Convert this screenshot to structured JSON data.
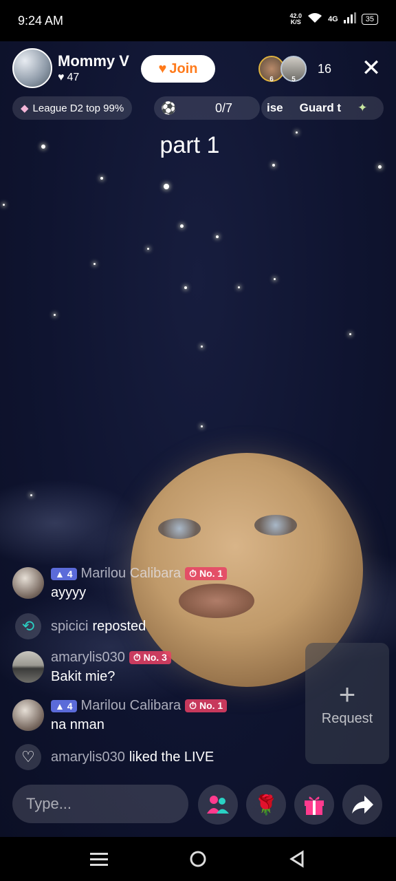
{
  "status": {
    "time": "9:24 AM",
    "net_speed_value": "42.0",
    "net_speed_unit": "K/S",
    "network": "4G",
    "battery": "35"
  },
  "header": {
    "host_name": "Mommy V",
    "host_likes": "47",
    "join_label": "Join",
    "viewer_badges": [
      "6",
      "5"
    ],
    "viewer_count": "16",
    "close_icon": "close-icon"
  },
  "chips": {
    "league": "League D2 top 99%",
    "goal_count": "0/7",
    "banner_left": "ise",
    "banner_right": "Guard t"
  },
  "caption": "part 1",
  "chat": [
    {
      "type": "comment",
      "level": "4",
      "name": "Marilou Calibara",
      "rank": "No. 1",
      "text": "ayyyy"
    },
    {
      "type": "event",
      "name": "spicici",
      "action": "reposted",
      "icon": "repost-icon"
    },
    {
      "type": "comment",
      "level": "",
      "name": "amarylis030",
      "rank": "No. 3",
      "text": "Bakit mie?"
    },
    {
      "type": "comment",
      "level": "4",
      "name": "Marilou Calibara",
      "rank": "No. 1",
      "text": "na nman"
    },
    {
      "type": "event",
      "name": "amarylis030",
      "action": "liked the LIVE",
      "icon": "heart-icon"
    }
  ],
  "request": {
    "label": "Request"
  },
  "bottom_bar": {
    "input_placeholder": "Type...",
    "buttons": [
      "people-icon",
      "rose-icon",
      "gift-icon",
      "share-icon"
    ]
  },
  "colors": {
    "join_text": "#ff7a1a",
    "level_badge": "#5b6bd9",
    "rank_badge": "#e84064",
    "sky": "#0f1430"
  }
}
